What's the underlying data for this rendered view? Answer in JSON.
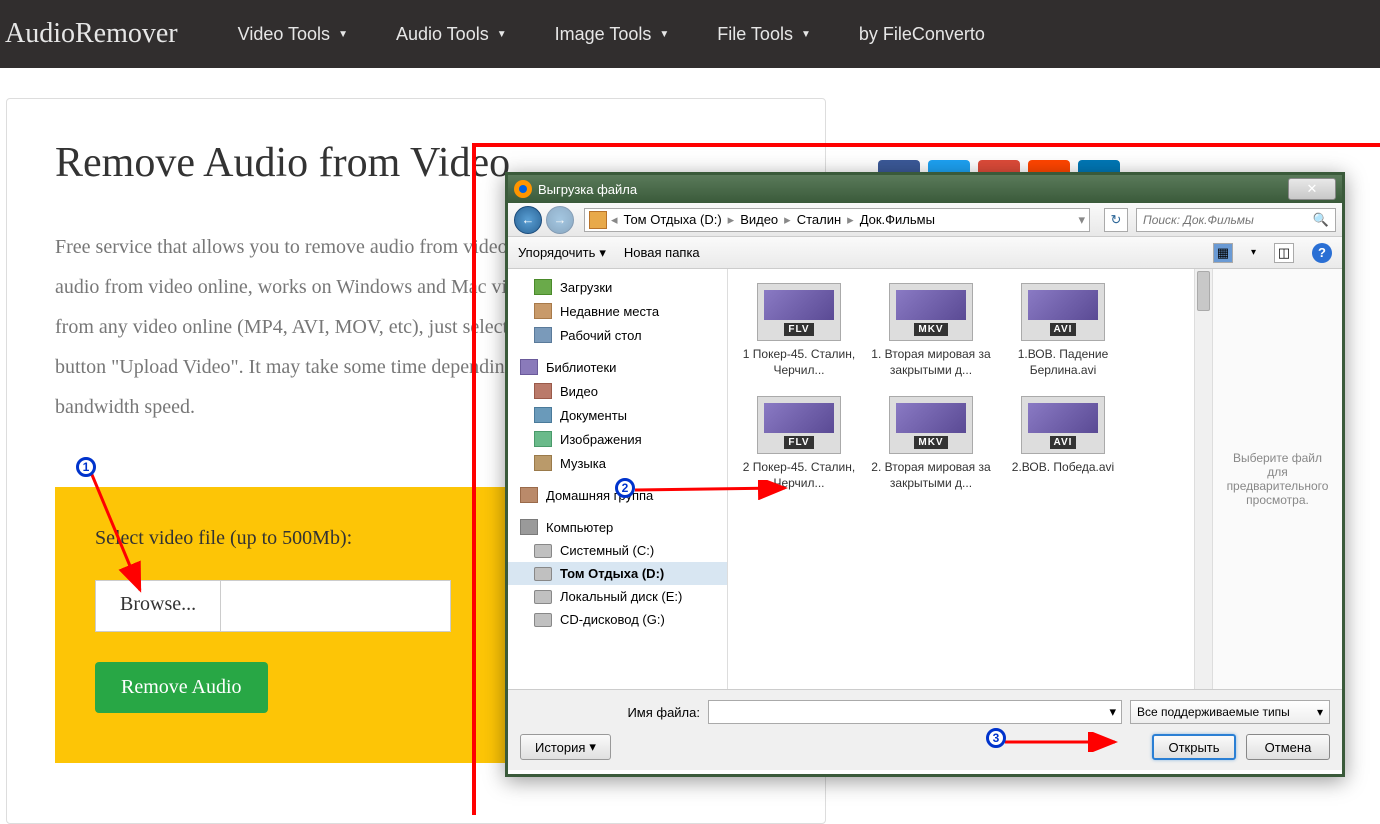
{
  "nav": {
    "brand": "AudioRemover",
    "items": [
      "Video Tools",
      "Audio Tools",
      "Image Tools",
      "File Tools"
    ],
    "by": "by FileConverto"
  },
  "page": {
    "title": "Remove Audio from Video",
    "body": "Free service that allows you to remove audio from video without re-encoding it. Remove audio from video online, works on Windows and Mac via web browser. Remove sound from any video online (MP4, AVI, MOV, etc), just select the video file and click the button \"Upload Video\". It may take some time depending on the video length and your bandwidth speed.",
    "upload_label": "Select video file (up to 500Mb):",
    "browse": "Browse...",
    "remove": "Remove Audio"
  },
  "dialog": {
    "title": "Выгрузка файла",
    "breadcrumb": [
      "Том Отдыха (D:)",
      "Видео",
      "Сталин",
      "Док.Фильмы"
    ],
    "search_placeholder": "Поиск: Док.Фильмы",
    "organize": "Упорядочить",
    "new_folder": "Новая папка",
    "tree": {
      "downloads": "Загрузки",
      "recent": "Недавние места",
      "desktop": "Рабочий стол",
      "libraries": "Библиотеки",
      "video": "Видео",
      "documents": "Документы",
      "images": "Изображения",
      "music": "Музыка",
      "homegroup": "Домашняя группа",
      "computer": "Компьютер",
      "drive_c": "Системный (C:)",
      "drive_d": "Том Отдыха (D:)",
      "drive_e": "Локальный диск (E:)",
      "drive_cd": "CD-дисковод (G:)"
    },
    "files": [
      {
        "ext": "FLV",
        "name": "1 Покер-45. Сталин, Черчил..."
      },
      {
        "ext": "MKV",
        "name": "1. Вторая мировая за закрытыми д..."
      },
      {
        "ext": "AVI",
        "name": "1.ВОВ. Падение Берлина.avi"
      },
      {
        "ext": "FLV",
        "name": "2 Покер-45. Сталин, Черчил..."
      },
      {
        "ext": "MKV",
        "name": "2. Вторая мировая за закрытыми д..."
      },
      {
        "ext": "AVI",
        "name": "2.ВОВ. Победа.avi"
      }
    ],
    "preview": "Выберите файл для предварительного просмотра.",
    "filename_label": "Имя файла:",
    "filter": "Все поддерживаемые типы",
    "history": "История",
    "open": "Открыть",
    "cancel": "Отмена"
  },
  "markers": {
    "m1": "1",
    "m2": "2",
    "m3": "3"
  }
}
